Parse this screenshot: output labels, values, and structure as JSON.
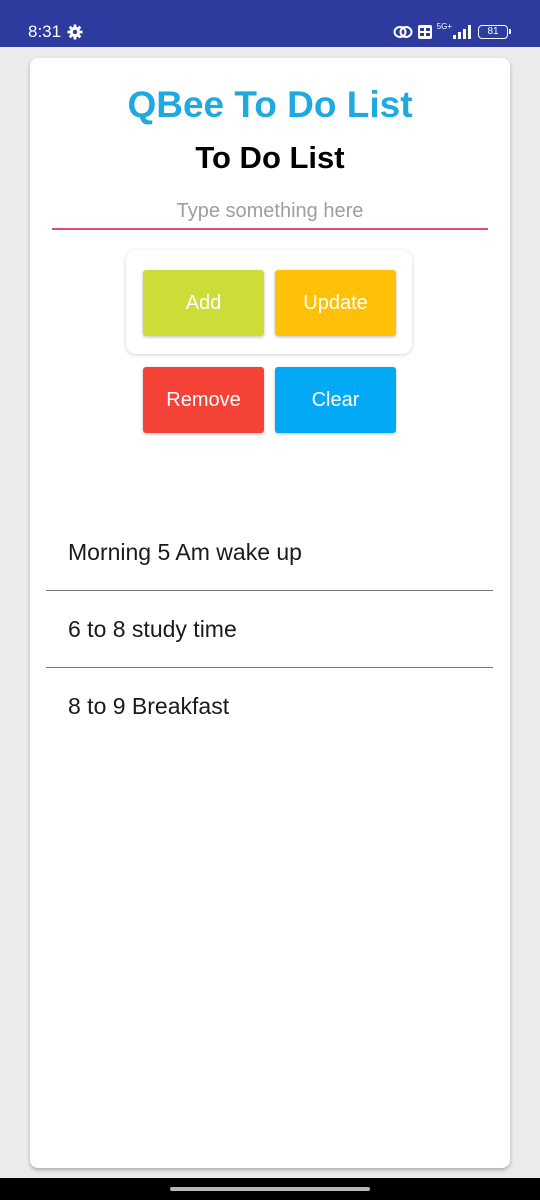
{
  "status_bar": {
    "time": "8:31",
    "network": "5G+",
    "battery": "81",
    "color": "#2d3a9e",
    "icons": [
      "gear-icon",
      "link-icon",
      "vowifi-icon",
      "signal-icon",
      "battery-icon"
    ]
  },
  "app": {
    "title": "QBee To Do List",
    "subtitle": "To Do List",
    "title_color": "#1ea9e1"
  },
  "input": {
    "placeholder": "Type something here",
    "value": "",
    "underline_color": "#e7477a"
  },
  "buttons": {
    "add": {
      "label": "Add",
      "color": "#cddc39"
    },
    "update": {
      "label": "Update",
      "color": "#ffc107"
    },
    "remove": {
      "label": "Remove",
      "color": "#f44336"
    },
    "clear": {
      "label": "Clear",
      "color": "#03a9f4"
    }
  },
  "tasks": [
    "Morning 5 Am wake up",
    "6 to 8 study time",
    "8 to 9 Breakfast"
  ]
}
